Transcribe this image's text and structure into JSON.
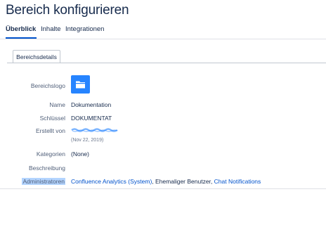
{
  "page": {
    "title": "Bereich konfigurieren"
  },
  "tabs": [
    {
      "label": "Überblick",
      "active": true
    },
    {
      "label": "Inhalte",
      "active": false
    },
    {
      "label": "Integrationen",
      "active": false
    }
  ],
  "subtab": {
    "label": "Bereichsdetails"
  },
  "details": {
    "logo_label": "Bereichslogo",
    "logo_icon": "folder-icon",
    "name_label": "Name",
    "name_value": "Dokumentation",
    "key_label": "Schlüssel",
    "key_value": "DOKUMENTAT",
    "created_label": "Erstellt von",
    "created_date": "(Nov 22, 2019)",
    "categories_label": "Kategorien",
    "categories_value": "(None)",
    "description_label": "Beschreibung",
    "admins_label": "Administratoren",
    "admins": {
      "first": "Confluence Analytics (System)",
      "sep1": ", ",
      "second": "Ehemaliger Benutzer",
      "sep2": ", ",
      "third": "Chat Notifications"
    }
  },
  "colors": {
    "accent": "#0052cc",
    "logo_bg": "#2684ff",
    "highlight": "#b3d4ff"
  }
}
